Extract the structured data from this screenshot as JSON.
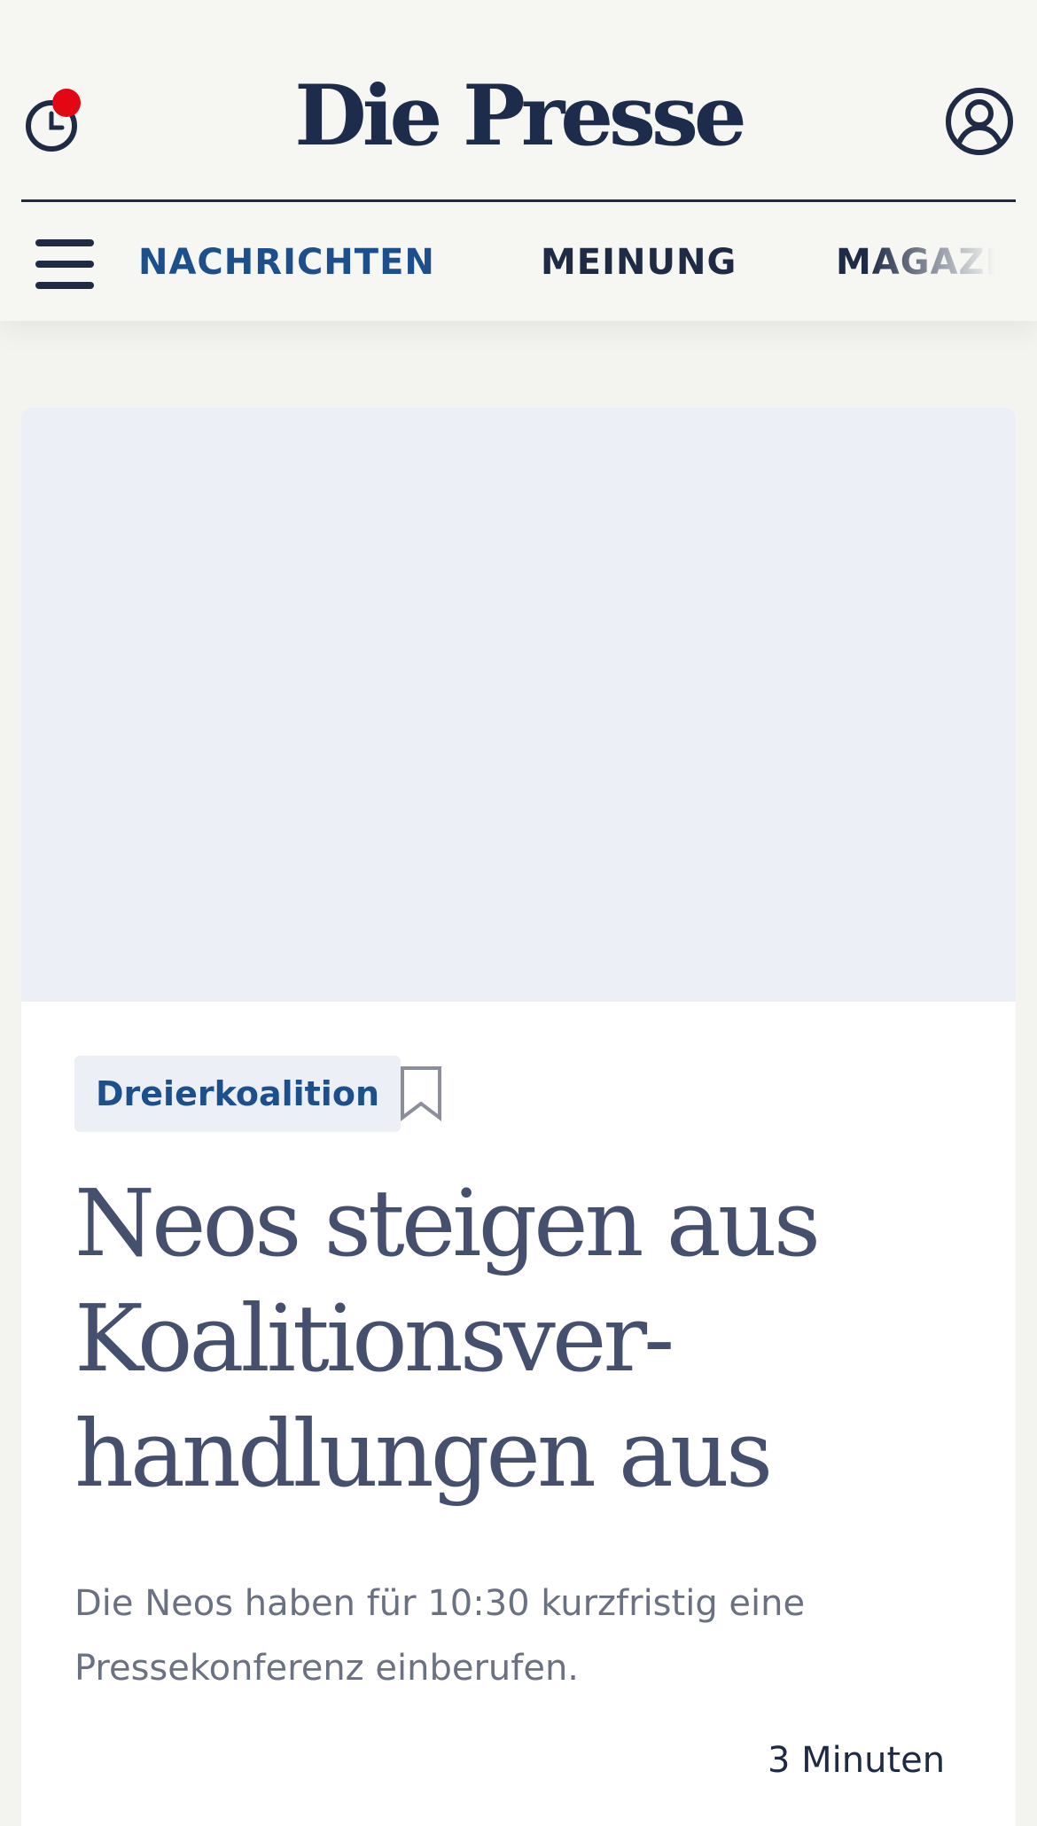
{
  "header": {
    "logo": "Die Presse",
    "notification_dot_color": "#e30613",
    "clock_icon": "clock-icon",
    "account_icon": "user-account-icon"
  },
  "nav": {
    "menu_icon": "hamburger-menu-icon",
    "items": [
      {
        "label": "NACHRICHTEN",
        "active": true
      },
      {
        "label": "MEINUNG",
        "active": false
      },
      {
        "label": "MAGAZIN",
        "active": false
      }
    ],
    "active_color": "#1d4f8c"
  },
  "article": {
    "tag": "Dreierkoalition",
    "bookmark_icon": "bookmark-icon",
    "headline_line1": "Neos steigen aus",
    "headline_line2": "Koalitionsver-",
    "headline_line3": "handlungen aus",
    "teaser": "Die Neos haben für 10:30 kurzfristig eine Pressekonferenz einberufen.",
    "read_time": "3 Minuten"
  },
  "colors": {
    "navy": "#1f2b45",
    "headline": "#45506e",
    "image_placeholder": "#ecf0f6"
  }
}
